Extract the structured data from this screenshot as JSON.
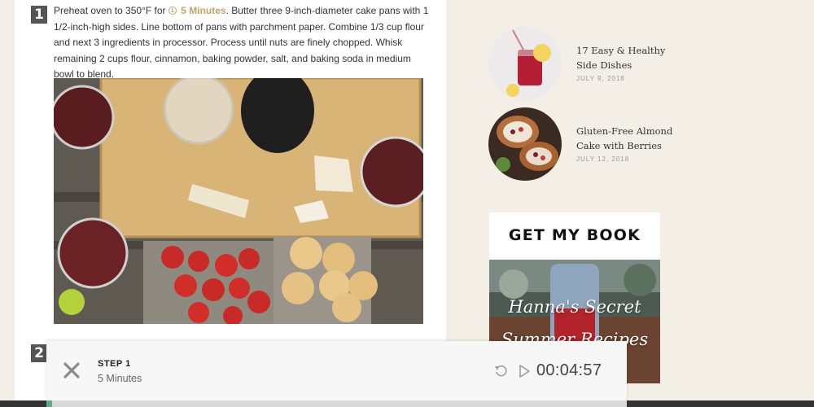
{
  "recipe": {
    "steps": [
      {
        "number": "1",
        "text_before": "Preheat oven to 350°F for ",
        "timer_label": "5 Minutes",
        "text_after": ". Butter three 9-inch-diameter cake pans with 1 1/2-inch-high sides. Line bottom of pans with parchment paper. Combine 1/3 cup flour and next 3 ingredients in processor. Process until nuts are finely chopped. Whisk remaining 2 cups flour, cinnamon, baking powder, salt, and baking soda in medium bowl to blend."
      },
      {
        "number": "2"
      }
    ]
  },
  "sidebar": {
    "posts": [
      {
        "title": "17 Easy & Healthy Side Dishes",
        "date": "JULY 9, 2018"
      },
      {
        "title": "Gluten-Free Almond Cake with Berries",
        "date": "JULY 12, 2018"
      }
    ],
    "book": {
      "heading": "GET MY BOOK",
      "cover_line1": "Hanna's Secret",
      "cover_line2": "Summer Recipes"
    }
  },
  "timer": {
    "step_label": "STEP 1",
    "duration": "5 Minutes",
    "remaining": "00:04:57",
    "progress": 0.01
  },
  "colors": {
    "accent_gold": "#c2a567",
    "progress_green": "#5fa889",
    "page_bg": "#f3efe6"
  },
  "icons": [
    "clock-icon",
    "close-icon",
    "reset-icon",
    "play-icon"
  ]
}
